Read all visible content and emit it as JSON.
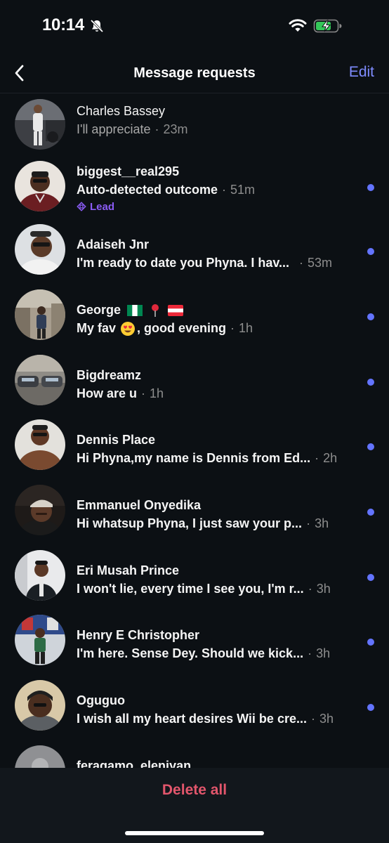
{
  "status_bar": {
    "time": "10:14"
  },
  "header": {
    "back_label": "",
    "title": "Message requests",
    "edit_label": "Edit"
  },
  "requests": [
    {
      "name": "Charles Bassey",
      "preview": "I'll appreciate",
      "time": "23m",
      "unread": false
    },
    {
      "name": "biggest__real295",
      "preview": "Auto-detected outcome",
      "time": "51m",
      "unread": true,
      "tag": "Lead"
    },
    {
      "name": "Adaiseh Jnr",
      "preview": "I'm ready to date you Phyna. I hav...",
      "time": "53m",
      "unread": true
    },
    {
      "name": "George",
      "preview": "My fav",
      "preview_suffix": ", good evening",
      "time": "1h",
      "unread": true
    },
    {
      "name": "Bigdreamz",
      "preview": "How are u",
      "time": "1h",
      "unread": true
    },
    {
      "name": "Dennis Place",
      "preview": "Hi Phyna,my name is Dennis from Ed...",
      "time": "2h",
      "unread": true
    },
    {
      "name": "Emmanuel Onyedika",
      "preview": "Hi whatsup Phyna, I just saw your p...",
      "time": "3h",
      "unread": true
    },
    {
      "name": "Eri Musah Prince",
      "preview": "I won't lie, every time I see you, I'm r...",
      "time": "3h",
      "unread": true
    },
    {
      "name": "Henry E Christopher",
      "preview": "I'm here. Sense Dey. Should we kick...",
      "time": "3h",
      "unread": true
    },
    {
      "name": "Oguguo",
      "preview": "I wish all my heart desires Wii be cre...",
      "time": "3h",
      "unread": true
    },
    {
      "name": "feragamo_eleniyan",
      "preview": "",
      "time": "",
      "unread": true
    }
  ],
  "separator": "·",
  "footer": {
    "delete_all_label": "Delete all"
  },
  "colors": {
    "background": "#0c1014",
    "accent_blue": "#7f8cff",
    "unread_dot": "#6374ff",
    "lead_purple": "#8b5cf6",
    "delete_red": "#e2566c"
  },
  "icons": {
    "back": "chevron-left-icon",
    "silent": "bell-slash-icon",
    "wifi": "wifi-icon",
    "battery": "battery-charging-icon",
    "lead": "lead-icon"
  }
}
